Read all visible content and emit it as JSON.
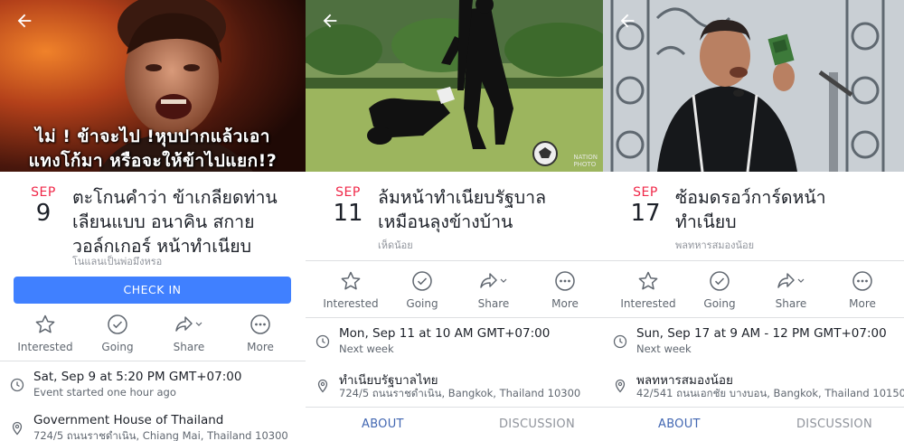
{
  "panels": [
    {
      "meme_line1": "ไม่ ! ข้าจะไป !หุบปากแล้วเอา",
      "meme_line2": "แทงโก้มา หรือจะให้ข้าไปแยก!?",
      "month": "SEP",
      "day": "9",
      "title_lines": [
        "ตะโกนคำว่า ข้าเกลียดท่าน",
        "เลียนแบบ อนาคิน สกาย",
        "วอล์กเกอร์ หน้าทำเนียบ"
      ],
      "host": "โนแลนเป็นพ่อมึงหรอ",
      "checkin_label": "CHECK IN",
      "actions": [
        "Interested",
        "Going",
        "Share",
        "More"
      ],
      "time_main": "Sat, Sep 9 at 5:20 PM GMT+07:00",
      "time_sub": "Event started one hour ago",
      "place_main": "Government House of Thailand",
      "place_sub": "724/5 ถนนราชดำเนิน, Chiang Mai, Thailand 10300"
    },
    {
      "month": "SEP",
      "day": "11",
      "title_lines": [
        "ล้มหน้าทำเนียบรัฐบาล",
        "เหมือนลุงข้างบ้าน"
      ],
      "host": "เห็ดน้อย",
      "watermark": "NATION\nPHOTO",
      "actions": [
        "Interested",
        "Going",
        "Share",
        "More"
      ],
      "time_main": "Mon, Sep 11 at 10 AM GMT+07:00",
      "time_sub": "Next week",
      "place_main": "ทำเนียบรัฐบาลไทย",
      "place_sub": "724/5 ถนนราชดำเนิน, Bangkok, Thailand 10300",
      "tabs": [
        "ABOUT",
        "DISCUSSION"
      ]
    },
    {
      "month": "SEP",
      "day": "17",
      "title_lines": [
        "ซ้อมดรอว์การ์ดหน้า",
        "ทำเนียบ"
      ],
      "host": "พลทหารสมองน้อย",
      "actions": [
        "Interested",
        "Going",
        "Share",
        "More"
      ],
      "time_main": "Sun, Sep 17 at 9 AM - 12 PM GMT+07:00",
      "time_sub": "Next week",
      "place_main": "พลทหารสมองน้อย",
      "place_sub": "42/541 ถนนเอกชัย บางบอน, Bangkok, Thailand 10150",
      "tabs": [
        "ABOUT",
        "DISCUSSION"
      ]
    }
  ],
  "colors": {
    "accent": "#4080ff",
    "month": "#f02849",
    "tab_active": "#4267b2"
  }
}
